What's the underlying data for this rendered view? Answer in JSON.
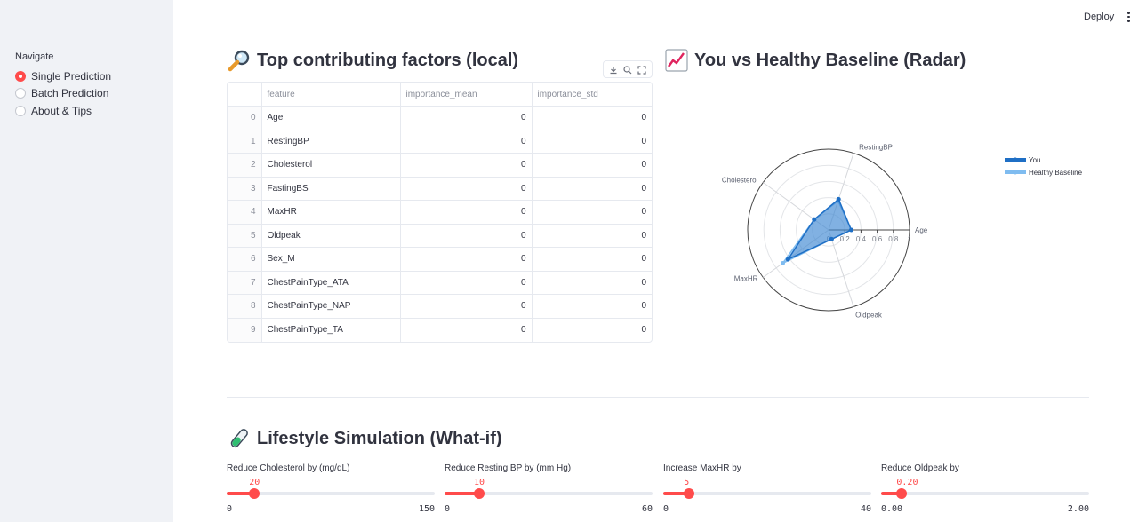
{
  "header": {
    "deploy_label": "Deploy",
    "menu_icon": "kebab-menu-icon"
  },
  "sidebar": {
    "title": "Navigate",
    "items": [
      {
        "label": "Single Prediction",
        "selected": true
      },
      {
        "label": "Batch Prediction",
        "selected": false
      },
      {
        "label": "About & Tips",
        "selected": false
      }
    ]
  },
  "factors": {
    "title": "Top contributing factors (local)",
    "icon": "magnifying-glass-icon",
    "toolbar_icons": [
      "download-icon",
      "search-icon",
      "fullscreen-icon"
    ],
    "columns": [
      "",
      "feature",
      "importance_mean",
      "importance_std"
    ],
    "rows": [
      [
        "0",
        "Age",
        "0",
        "0"
      ],
      [
        "1",
        "RestingBP",
        "0",
        "0"
      ],
      [
        "2",
        "Cholesterol",
        "0",
        "0"
      ],
      [
        "3",
        "FastingBS",
        "0",
        "0"
      ],
      [
        "4",
        "MaxHR",
        "0",
        "0"
      ],
      [
        "5",
        "Oldpeak",
        "0",
        "0"
      ],
      [
        "6",
        "Sex_M",
        "0",
        "0"
      ],
      [
        "7",
        "ChestPainType_ATA",
        "0",
        "0"
      ],
      [
        "8",
        "ChestPainType_NAP",
        "0",
        "0"
      ],
      [
        "9",
        "ChestPainType_TA",
        "0",
        "0"
      ]
    ]
  },
  "radar": {
    "title": "You vs Healthy Baseline (Radar)",
    "icon": "chart-increasing-icon"
  },
  "chart_data": {
    "type": "radar",
    "categories": [
      "Age",
      "RestingBP",
      "Cholesterol",
      "MaxHR",
      "Oldpeak"
    ],
    "radial_ticks": [
      "0",
      "0.2",
      "0.4",
      "0.6",
      "0.8",
      "1"
    ],
    "range": [
      0,
      1
    ],
    "series": [
      {
        "name": "You",
        "values": [
          0.28,
          0.4,
          0.22,
          0.62,
          0.12
        ],
        "color": "#1f6fc5"
      },
      {
        "name": "Healthy Baseline",
        "values": [
          0.28,
          0.38,
          0.22,
          0.7,
          0.12
        ],
        "color": "#7fbcf0"
      }
    ],
    "legend_position": "top-right",
    "grid": true
  },
  "simulation": {
    "title": "Lifestyle Simulation (What-if)",
    "icon": "test-tube-icon",
    "sliders": [
      {
        "label": "Reduce Cholesterol by (mg/dL)",
        "value": 20,
        "display": "20",
        "min": 0,
        "max": 150,
        "min_label": "0",
        "max_label": "150"
      },
      {
        "label": "Reduce Resting BP by (mm Hg)",
        "value": 10,
        "display": "10",
        "min": 0,
        "max": 60,
        "min_label": "0",
        "max_label": "60"
      },
      {
        "label": "Increase MaxHR by",
        "value": 5,
        "display": "5",
        "min": 0,
        "max": 40,
        "min_label": "0",
        "max_label": "40"
      },
      {
        "label": "Reduce Oldpeak by",
        "value": 0.2,
        "display": "0.20",
        "min": 0,
        "max": 2,
        "min_label": "0.00",
        "max_label": "2.00"
      }
    ]
  },
  "colors": {
    "accent": "#ff4b4b",
    "sidebar_bg": "#f0f2f6",
    "text": "#31333f"
  }
}
